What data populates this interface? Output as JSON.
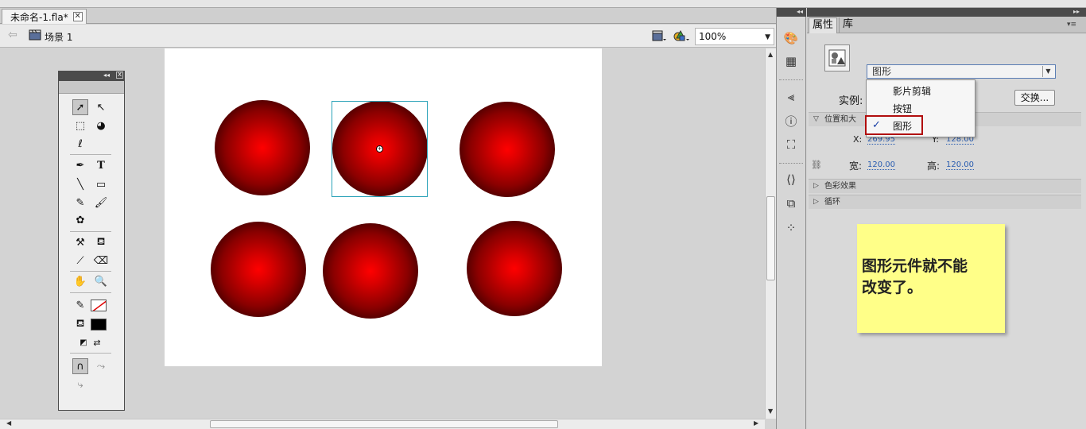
{
  "document": {
    "tab_title": "未命名-1.fla*",
    "tab_close": "✕"
  },
  "scene": {
    "back_arrow": "⇦",
    "name": "场景 1",
    "zoom": "100%"
  },
  "stage": {
    "instances": 6,
    "selected_index": 1
  },
  "tools": {
    "panel": "tools",
    "icons": [
      "selection-tool",
      "subselection-tool",
      "free-transform-tool",
      "3d-rotation-tool",
      "lasso-tool",
      "pen-tool",
      "text-tool",
      "line-tool",
      "rectangle-tool",
      "pencil-tool",
      "brush-tool",
      "deco-tool",
      "bone-tool",
      "paint-bucket-tool",
      "eyedropper-tool",
      "eraser-tool",
      "hand-tool",
      "zoom-tool",
      "stroke-color",
      "fill-color",
      "swap-colors",
      "snap-to-objects",
      "smooth",
      "straighten"
    ]
  },
  "properties": {
    "tabs": [
      "属性",
      "库"
    ],
    "symbol_type": "图形",
    "instance_label": "实例:",
    "swap_button": "交换...",
    "section_position": "位置和大",
    "x_label": "X:",
    "x_value": "269.95",
    "y_label": "Y:",
    "y_value": "128.00",
    "width_label": "宽:",
    "width_value": "120.00",
    "height_label": "高:",
    "height_value": "120.00",
    "section_color": "色彩效果",
    "section_loop": "循环"
  },
  "dropdown": {
    "items": [
      "影片剪辑",
      "按钮",
      "图形"
    ],
    "checked": "图形",
    "check_mark": "✓"
  },
  "note": {
    "line1": "图形元件就不能",
    "line2": "改变了。"
  },
  "colors": {
    "accent_red": "#b10d0d",
    "selection": "#2aa2b8",
    "note_bg": "#ffff88"
  }
}
